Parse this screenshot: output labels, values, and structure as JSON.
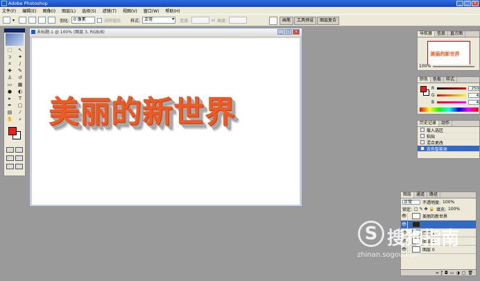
{
  "app": {
    "title": "Adobe Photoshop"
  },
  "menu": [
    "文件(F)",
    "编辑(E)",
    "图像(I)",
    "图层(L)",
    "选择(S)",
    "滤镜(T)",
    "视图(V)",
    "窗口(W)",
    "帮助(H)"
  ],
  "options": {
    "feather_label": "羽化:",
    "feather_value": "0 像素",
    "antialias_label": "消除锯齿",
    "style_label": "样式:",
    "style_value": "正常",
    "width_label": "宽度:",
    "height_label": "高度:"
  },
  "palette_well": {
    "tabs": [
      "画笔",
      "工具预设",
      "图层复合"
    ]
  },
  "document": {
    "title": "未标题-1 @ 100% (图层 3, RGB/8)",
    "art_text": "美丽的新世界"
  },
  "navigator": {
    "tabs": [
      "导航器",
      "信息",
      "直方图"
    ],
    "thumb_text": "美丽的新世界",
    "zoom": "100%"
  },
  "color_panel": {
    "tabs": [
      "颜色",
      "色板",
      "样式"
    ],
    "fg_color": "#e8201c",
    "channels": [
      {
        "label": "R",
        "value": "250"
      },
      {
        "label": "G",
        "value": "4"
      },
      {
        "label": "B",
        "value": "4"
      }
    ]
  },
  "history": {
    "tabs": [
      "历史记录",
      "动作"
    ],
    "items": [
      {
        "label": "载入选区",
        "selected": false
      },
      {
        "label": "粘贴",
        "selected": false
      },
      {
        "label": "混合更改",
        "selected": false
      },
      {
        "label": "去色智能体",
        "selected": true
      }
    ]
  },
  "layers": {
    "tabs": [
      "图层",
      "通道",
      "路径"
    ],
    "blend_mode": "正常",
    "opacity_label": "不透明度:",
    "opacity_value": "100%",
    "lock_label": "锁定:",
    "fill_label": "填充:",
    "fill_value": "100%",
    "items": [
      {
        "label": "美丽的新世界",
        "selected": false
      },
      {
        "label": "",
        "selected": true
      },
      {
        "label": "图层 2",
        "selected": false
      },
      {
        "label": "图层 1",
        "selected": false
      },
      {
        "label": "图层 0",
        "selected": false
      }
    ]
  },
  "watermark": {
    "main": "搜狗指南",
    "sub": "zhinan.sogou.com"
  }
}
